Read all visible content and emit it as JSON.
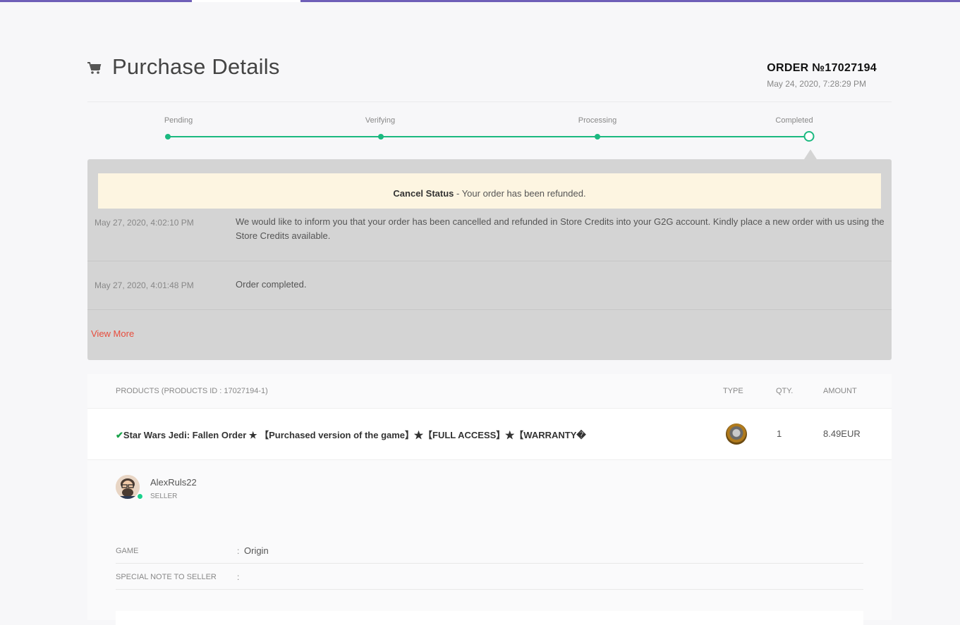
{
  "header": {
    "title": "Purchase Details",
    "order_number": "ORDER №17027194",
    "order_date": "May 24, 2020, 7:28:29 PM"
  },
  "steps": [
    "Pending",
    "Verifying",
    "Processing",
    "Completed"
  ],
  "status": {
    "cancel_label": "Cancel Status",
    "cancel_text": " - Your order has been refunded.",
    "logs": [
      {
        "time": "May 27, 2020, 4:02:10 PM",
        "message": "We would like to inform you that your order has been cancelled and refunded in Store Credits into your G2G account. Kindly place a new order with us using the Store Credits available."
      },
      {
        "time": "May 27, 2020, 4:01:48 PM",
        "message": "Order completed."
      }
    ],
    "view_more": "View More"
  },
  "products": {
    "headers": {
      "products": "PRODUCTS (PRODUCTS ID : 17027194-1)",
      "type": "TYPE",
      "qty": "QTY.",
      "amount": "AMOUNT"
    },
    "item": {
      "check": "✔",
      "name": "Star Wars Jedi: Fallen Order ★ 【Purchased version of the game】★【FULL ACCESS】★【WARRANTY�",
      "qty": "1",
      "amount": "8.49EUR"
    }
  },
  "seller": {
    "name": "AlexRuls22",
    "role": "SELLER"
  },
  "details": [
    {
      "label": "GAME",
      "colon": ":",
      "value": "Origin"
    },
    {
      "label": "SPECIAL NOTE TO SELLER",
      "colon": ":",
      "value": ""
    }
  ],
  "colors": {
    "accent": "#6f5fb8",
    "progress": "#1bb980",
    "link": "#e74c3c",
    "banner": "#fdf5e1"
  }
}
